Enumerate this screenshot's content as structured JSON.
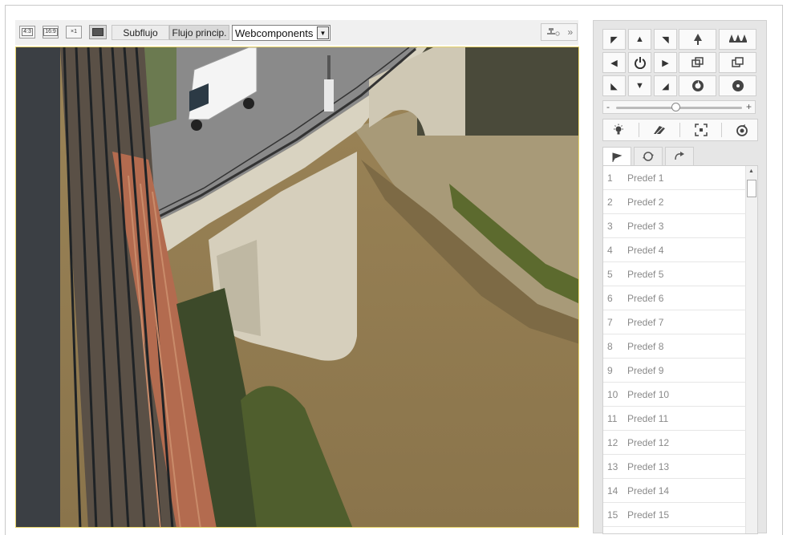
{
  "toolbar": {
    "ratio_4_3": "4:3",
    "ratio_16_9": "16:9",
    "ratio_x1": "×1",
    "sub_stream": "Subflujo",
    "main_stream": "Flujo princip.",
    "plugin_select": "Webcomponents",
    "expand_label": "»"
  },
  "ptz": {
    "center_icon": "power-icon"
  },
  "zoom": {
    "slider_value_fraction": 0.47,
    "minus": "-",
    "plus": "+"
  },
  "presets": [
    {
      "num": "1",
      "name": "Predef 1"
    },
    {
      "num": "2",
      "name": "Predef 2"
    },
    {
      "num": "3",
      "name": "Predef 3"
    },
    {
      "num": "4",
      "name": "Predef 4"
    },
    {
      "num": "5",
      "name": "Predef 5"
    },
    {
      "num": "6",
      "name": "Predef 6"
    },
    {
      "num": "7",
      "name": "Predef 7"
    },
    {
      "num": "8",
      "name": "Predef 8"
    },
    {
      "num": "9",
      "name": "Predef 9"
    },
    {
      "num": "10",
      "name": "Predef 10"
    },
    {
      "num": "11",
      "name": "Predef 11"
    },
    {
      "num": "12",
      "name": "Predef 12"
    },
    {
      "num": "13",
      "name": "Predef 13"
    },
    {
      "num": "14",
      "name": "Predef 14"
    },
    {
      "num": "15",
      "name": "Predef 15"
    }
  ],
  "colors": {
    "video_border": "#e8d46a",
    "panel_bg": "#e6e6e6",
    "preset_text": "#8a8a8a"
  }
}
